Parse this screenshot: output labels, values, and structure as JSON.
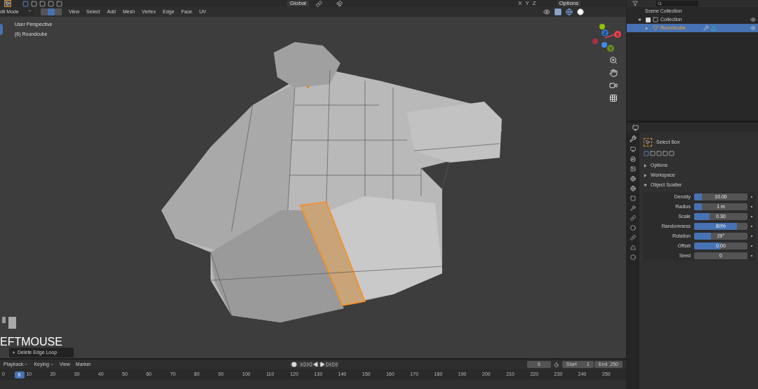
{
  "top_header": {
    "orientation": "Global",
    "axes": [
      "X",
      "Y",
      "Z"
    ],
    "options": "Options"
  },
  "viewport_header": {
    "mode": "dit Mode",
    "select_modes": [
      {
        "selected": false
      },
      {
        "selected": true
      },
      {
        "selected": false
      }
    ],
    "menus": [
      "View",
      "Select",
      "Add",
      "Mesh",
      "Vertex",
      "Edge",
      "Face",
      "UV"
    ]
  },
  "viewport": {
    "perspective": "User Perspective",
    "object": "(6) Roundcube",
    "gizmo": [
      {
        "label": "Z",
        "color": "#2f6fc4"
      },
      {
        "label": "X",
        "color": "#e8434f"
      },
      {
        "label": "Y",
        "color": "#6a8e1e"
      }
    ],
    "key_overlay": "EFTMOUSE",
    "last_operator": "Delete Edge Loop"
  },
  "outliner": {
    "title": "Scene Collection",
    "items": [
      {
        "label": "Collection",
        "expanded": true,
        "checked": true,
        "selected": false,
        "children": [
          {
            "label": "Roundcube",
            "expanded": false,
            "selected": true
          }
        ]
      }
    ]
  },
  "properties": {
    "tool": "Select Box",
    "sections": [
      {
        "label": "Options",
        "expanded": false
      },
      {
        "label": "Workspace",
        "expanded": false
      },
      {
        "label": "Object Scatter",
        "expanded": true
      }
    ],
    "fields": [
      {
        "label": "Density",
        "value": "10.00",
        "level": 0.14
      },
      {
        "label": "Radius",
        "value": "1 m",
        "level": 0.14
      },
      {
        "label": "Scale",
        "value": "0.30",
        "level": 0.29
      },
      {
        "label": "Randomness",
        "value": "80%",
        "level": 0.8
      },
      {
        "label": "Rotation",
        "value": "29°",
        "level": 0.31
      },
      {
        "label": "Offset",
        "value": "0.00",
        "level": 0.5
      },
      {
        "label": "Seed",
        "value": "0",
        "level": 0
      }
    ]
  },
  "timeline": {
    "menus": [
      {
        "label": "Playback",
        "kind": "dropdown"
      },
      {
        "label": "Keying",
        "kind": "dropdown"
      },
      {
        "label": "View",
        "kind": "plain"
      },
      {
        "label": "Marker",
        "kind": "plain"
      }
    ],
    "current_frame": "6",
    "start_label": "Start",
    "start": "1",
    "end_label": "End",
    "end": "250",
    "playhead": "6",
    "ticks": [
      "0",
      "10",
      "20",
      "30",
      "40",
      "50",
      "60",
      "70",
      "80",
      "90",
      "100",
      "110",
      "120",
      "130",
      "140",
      "150",
      "160",
      "170",
      "180",
      "190",
      "200",
      "210",
      "220",
      "230",
      "240",
      "250"
    ]
  }
}
